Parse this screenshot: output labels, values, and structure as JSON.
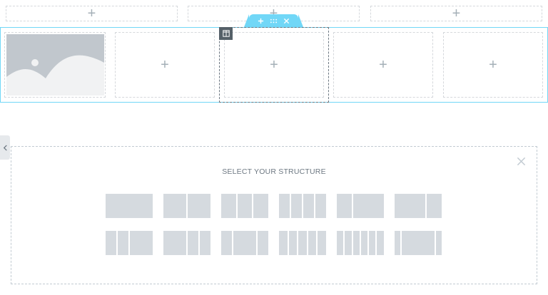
{
  "top_row": {
    "cells": [
      "+",
      "+",
      "+"
    ]
  },
  "section_handle": {
    "add_icon": "plus-icon",
    "move_icon": "drag-handle-icon",
    "delete_icon": "close-icon"
  },
  "section": {
    "image_placeholder_icon": "image-placeholder-icon",
    "empty_columns": [
      "+",
      "+",
      "+",
      "+"
    ],
    "column_tag_icon": "column-icon"
  },
  "panel_toggle": {
    "icon": "chevron-left-icon"
  },
  "structure_selector": {
    "title": "SELECT YOUR STRUCTURE",
    "close_icon": "close-icon"
  },
  "colors": {
    "accent": "#71d7f7",
    "placeholder": "#d5dadf",
    "dark_tag": "#556068",
    "muted_text": "#6d7882"
  }
}
